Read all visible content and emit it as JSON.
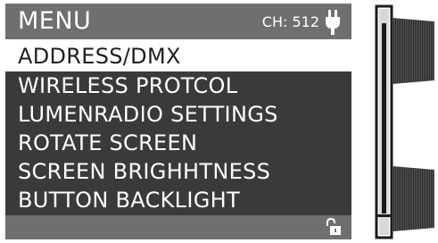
{
  "header": {
    "title": "MENU",
    "channel_label": "CH: 512",
    "power_icon": "plug-icon"
  },
  "menu": {
    "items": [
      {
        "label": "ADDRESS/DMX",
        "selected": true
      },
      {
        "label": "WIRELESS PROTCOL",
        "selected": false
      },
      {
        "label": "LUMENRADIO SETTINGS",
        "selected": false
      },
      {
        "label": "ROTATE SCREEN",
        "selected": false
      },
      {
        "label": "SCREEN BRIGHHTNESS",
        "selected": false
      },
      {
        "label": "BUTTON BACKLIGHT",
        "selected": false
      }
    ]
  },
  "footer": {
    "lock_icon": "unlocked-padlock-icon"
  },
  "colors": {
    "header_bg": "#6f6f6f",
    "list_bg": "#3a3a3a",
    "selected_bg": "#ffffff",
    "text": "#ffffff",
    "selected_text": "#1f1f1f"
  }
}
